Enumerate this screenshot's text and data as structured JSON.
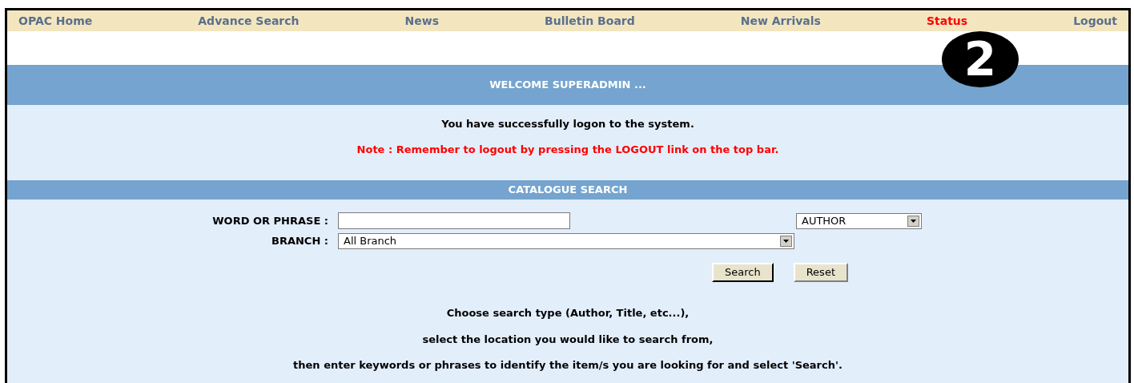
{
  "nav": [
    {
      "label": "OPAC Home",
      "selected": false
    },
    {
      "label": "Advance Search",
      "selected": false
    },
    {
      "label": "News",
      "selected": false
    },
    {
      "label": "Bulletin Board",
      "selected": false
    },
    {
      "label": "New Arrivals",
      "selected": false
    },
    {
      "label": "Status",
      "selected": true
    },
    {
      "label": "Logout",
      "selected": false
    }
  ],
  "callout": "2",
  "welcome": {
    "title": "WELCOME SUPERADMIN ...",
    "message": "You have successfully logon to the system.",
    "note": "Note : Remember to logout by pressing the LOGOUT link on the top bar."
  },
  "search": {
    "title": "CATALOGUE SEARCH",
    "word_label": "WORD OR PHRASE :",
    "search_type": "AUTHOR",
    "branch_label": "BRANCH :",
    "branch": "All Branch",
    "buttons": [
      "Search",
      "Reset"
    ],
    "help": [
      "Choose search type (Author, Title, etc...),",
      "select the location you would like to search from,",
      "then enter keywords or phrases to identify the item/s you are looking for and select 'Search'."
    ]
  }
}
